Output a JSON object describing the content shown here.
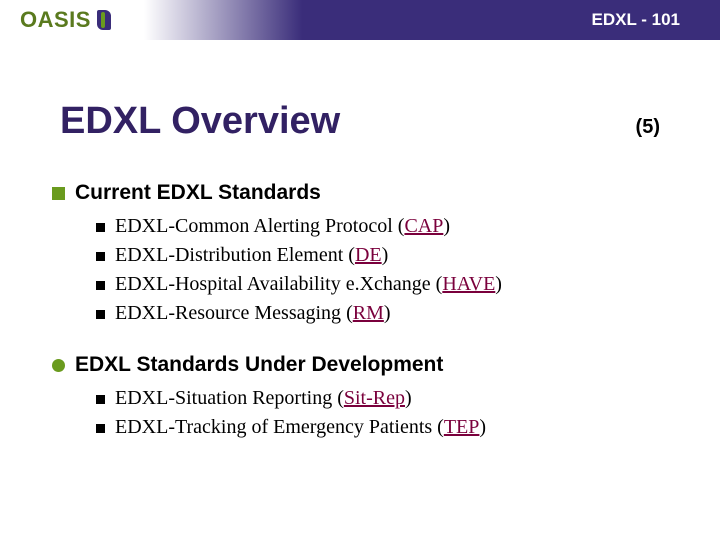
{
  "header": {
    "logo": "OASIS",
    "label": "EDXL - 101"
  },
  "title": "EDXL Overview",
  "page": "(5)",
  "sections": [
    {
      "bullet": "square",
      "title": "Current EDXL Standards",
      "items": [
        {
          "prefix": "EDXL-Common Alerting Protocol",
          "acronym": "CAP"
        },
        {
          "prefix": "EDXL-Distribution Element",
          "acronym": "DE"
        },
        {
          "prefix": "EDXL-Hospital Availability e.Xchange",
          "acronym": "HAVE"
        },
        {
          "prefix": "EDXL-Resource Messaging",
          "acronym": "RM"
        }
      ]
    },
    {
      "bullet": "circle",
      "title": "EDXL Standards Under Development",
      "items": [
        {
          "prefix": "EDXL-Situation Reporting",
          "acronym": "Sit-Rep"
        },
        {
          "prefix": "EDXL-Tracking of Emergency Patients",
          "acronym": "TEP"
        }
      ]
    }
  ]
}
